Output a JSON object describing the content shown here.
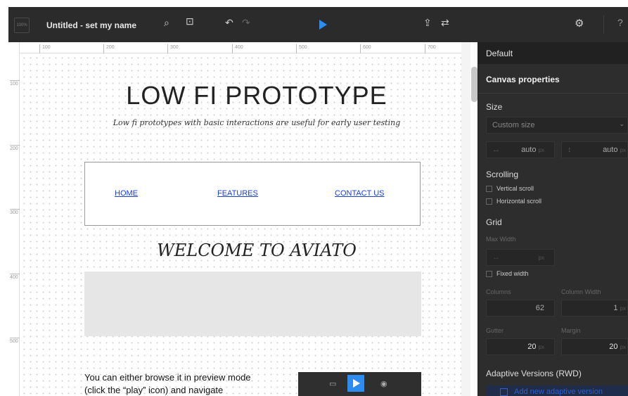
{
  "toolbar": {
    "zoom": "100%",
    "doc_title": "Untitled - set my name",
    "search_icon": "search-icon",
    "fit_icon": "fit-screen-icon",
    "undo_icon": "undo-icon",
    "redo_icon": "redo-icon",
    "play_icon": "play-icon",
    "export_icon": "export-icon",
    "share_icon": "share-icon",
    "settings_icon": "gear-icon",
    "help_label": "?"
  },
  "rulers": {
    "top": [
      "100",
      "200",
      "300",
      "400",
      "500",
      "600",
      "700"
    ],
    "left": [
      "100",
      "200",
      "300",
      "400",
      "500"
    ]
  },
  "canvas": {
    "title": "LOW FI PROTOTYPE",
    "subtitle": "Low fi prototypes with basic interactions are useful for early user testing",
    "nav": [
      "HOME",
      "FEATURES",
      "CONTACT US"
    ],
    "welcome": "WELCOME TO AVIATO",
    "body_line1": "You can either browse it in preview mode",
    "body_line2": "(click the “play” icon) and navigate"
  },
  "panel": {
    "default_label": "Default",
    "heading": "Canvas properties",
    "size_label": "Size",
    "size_select": "Custom size",
    "width_value": "auto",
    "height_value": "auto",
    "unit": "px",
    "scrolling_label": "Scrolling",
    "vertical_scroll": "Vertical scroll",
    "horizontal_scroll": "Horizontal scroll",
    "grid_label": "Grid",
    "max_width_label": "Max Width",
    "fixed_width": "Fixed width",
    "columns_label": "Columns",
    "columns_value": "62",
    "column_width_label": "Column Width",
    "column_width_value": "1",
    "gutter_label": "Gutter",
    "gutter_value": "20",
    "margin_label": "Margin",
    "margin_value": "20",
    "adaptive_label": "Adaptive Versions (RWD)",
    "add_adaptive": "Add new adaptive version"
  }
}
